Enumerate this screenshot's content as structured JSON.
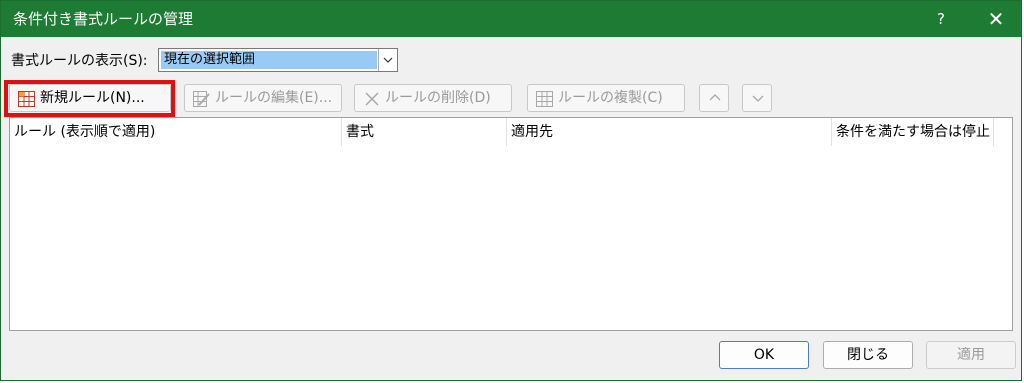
{
  "window": {
    "title": "条件付き書式ルールの管理",
    "help_glyph": "?",
    "close_glyph": "✕"
  },
  "show_rules": {
    "label": "書式ルールの表示(S):",
    "selected_value": "現在の選択範囲"
  },
  "toolbar": {
    "new_rule": "新規ルール(N)...",
    "edit_rule": "ルールの編集(E)...",
    "delete_rule": "ルールの削除(D)",
    "duplicate_rule": "ルールの複製(C)",
    "move_up_glyph": "∧",
    "move_down_glyph": "∨"
  },
  "rules_table": {
    "columns": [
      "ルール (表示順で適用)",
      "書式",
      "適用先",
      "条件を満たす場合は停止"
    ],
    "rows": []
  },
  "footer": {
    "ok": "OK",
    "close": "閉じる",
    "apply": "適用"
  },
  "colors": {
    "titlebar": "#1e7b34",
    "highlight": "#e01010",
    "selection": "#99c9f5"
  }
}
